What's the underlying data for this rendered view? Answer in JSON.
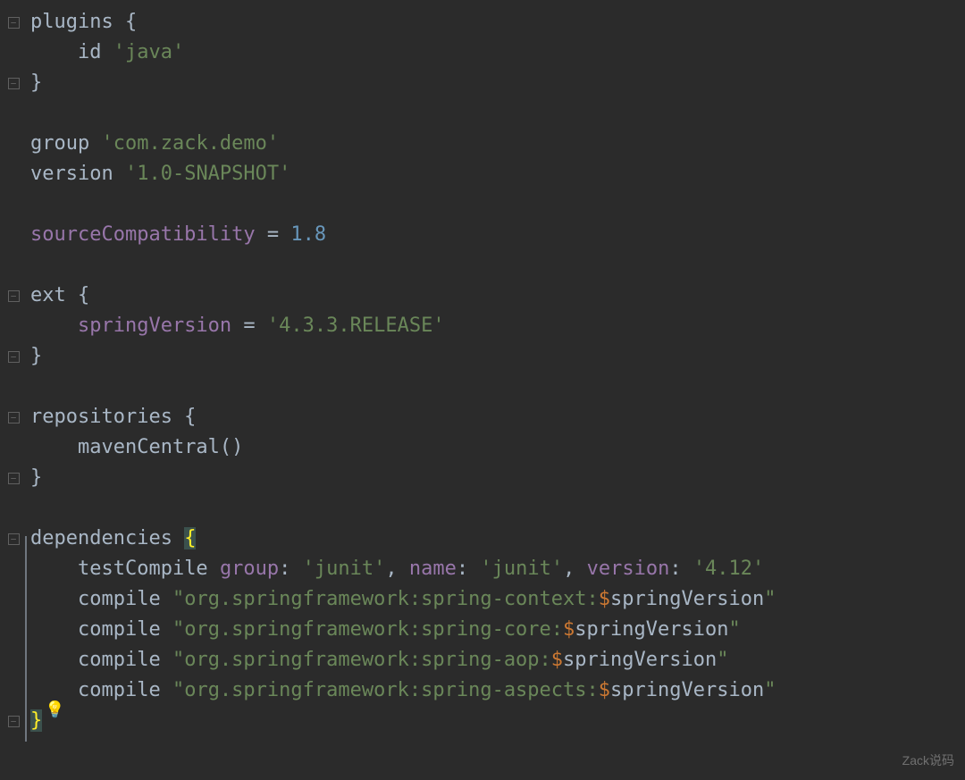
{
  "lines": [
    {
      "indent": 0,
      "tokens": [
        {
          "t": "ident",
          "v": "plugins {"
        }
      ],
      "fold": "open"
    },
    {
      "indent": 1,
      "tokens": [
        {
          "t": "ident",
          "v": "id "
        },
        {
          "t": "str",
          "v": "'java'"
        }
      ]
    },
    {
      "indent": 0,
      "tokens": [
        {
          "t": "ident",
          "v": "}"
        }
      ],
      "fold": "close"
    },
    {
      "indent": 0,
      "tokens": []
    },
    {
      "indent": 0,
      "tokens": [
        {
          "t": "ident",
          "v": "group "
        },
        {
          "t": "str",
          "v": "'com.zack.demo'"
        }
      ]
    },
    {
      "indent": 0,
      "tokens": [
        {
          "t": "ident",
          "v": "version "
        },
        {
          "t": "str",
          "v": "'1.0-SNAPSHOT'"
        }
      ]
    },
    {
      "indent": 0,
      "tokens": []
    },
    {
      "indent": 0,
      "tokens": [
        {
          "t": "prop",
          "v": "sourceCompatibility"
        },
        {
          "t": "ident",
          "v": " = "
        },
        {
          "t": "num",
          "v": "1.8"
        }
      ]
    },
    {
      "indent": 0,
      "tokens": []
    },
    {
      "indent": 0,
      "tokens": [
        {
          "t": "ident",
          "v": "ext {"
        }
      ],
      "fold": "open"
    },
    {
      "indent": 1,
      "tokens": [
        {
          "t": "prop",
          "v": "springVersion"
        },
        {
          "t": "ident",
          "v": " = "
        },
        {
          "t": "str",
          "v": "'4.3.3.RELEASE'"
        }
      ]
    },
    {
      "indent": 0,
      "tokens": [
        {
          "t": "ident",
          "v": "}"
        }
      ],
      "fold": "close"
    },
    {
      "indent": 0,
      "tokens": []
    },
    {
      "indent": 0,
      "tokens": [
        {
          "t": "ident",
          "v": "repositories {"
        }
      ],
      "fold": "open"
    },
    {
      "indent": 1,
      "tokens": [
        {
          "t": "ident",
          "v": "mavenCentral()"
        }
      ]
    },
    {
      "indent": 0,
      "tokens": [
        {
          "t": "ident",
          "v": "}"
        }
      ],
      "fold": "close"
    },
    {
      "indent": 0,
      "tokens": []
    },
    {
      "indent": 0,
      "tokens": [
        {
          "t": "ident",
          "v": "dependencies "
        },
        {
          "t": "brace-hl",
          "v": "{"
        }
      ],
      "fold": "open"
    },
    {
      "indent": 1,
      "tokens": [
        {
          "t": "ident",
          "v": "testCompile "
        },
        {
          "t": "prop",
          "v": "group"
        },
        {
          "t": "ident",
          "v": ": "
        },
        {
          "t": "str",
          "v": "'junit'"
        },
        {
          "t": "ident",
          "v": ", "
        },
        {
          "t": "prop",
          "v": "name"
        },
        {
          "t": "ident",
          "v": ": "
        },
        {
          "t": "str",
          "v": "'junit'"
        },
        {
          "t": "ident",
          "v": ", "
        },
        {
          "t": "prop",
          "v": "version"
        },
        {
          "t": "ident",
          "v": ": "
        },
        {
          "t": "str",
          "v": "'4.12'"
        }
      ]
    },
    {
      "indent": 1,
      "tokens": [
        {
          "t": "ident",
          "v": "compile "
        },
        {
          "t": "str",
          "v": "\"org.springframework:spring-context:"
        },
        {
          "t": "kw",
          "v": "$"
        },
        {
          "t": "ident",
          "v": "springVersion"
        },
        {
          "t": "str",
          "v": "\""
        }
      ]
    },
    {
      "indent": 1,
      "tokens": [
        {
          "t": "ident",
          "v": "compile "
        },
        {
          "t": "str",
          "v": "\"org.springframework:spring-core:"
        },
        {
          "t": "kw",
          "v": "$"
        },
        {
          "t": "ident",
          "v": "springVersion"
        },
        {
          "t": "str",
          "v": "\""
        }
      ]
    },
    {
      "indent": 1,
      "tokens": [
        {
          "t": "ident",
          "v": "compile "
        },
        {
          "t": "str",
          "v": "\"org.springframework:spring-aop:"
        },
        {
          "t": "kw",
          "v": "$"
        },
        {
          "t": "ident",
          "v": "springVersion"
        },
        {
          "t": "str",
          "v": "\""
        }
      ]
    },
    {
      "indent": 1,
      "tokens": [
        {
          "t": "ident",
          "v": "compile "
        },
        {
          "t": "str",
          "v": "\"org.springframework:spring-aspects:"
        },
        {
          "t": "kw",
          "v": "$"
        },
        {
          "t": "ident",
          "v": "springVersion"
        },
        {
          "t": "str",
          "v": "\""
        }
      ],
      "bulb": true
    },
    {
      "indent": 0,
      "tokens": [
        {
          "t": "brace-hl",
          "v": "}"
        }
      ],
      "fold": "close"
    }
  ],
  "watermark": "Zack说码",
  "indent_spaces": "    ",
  "bulb_icon": "💡"
}
